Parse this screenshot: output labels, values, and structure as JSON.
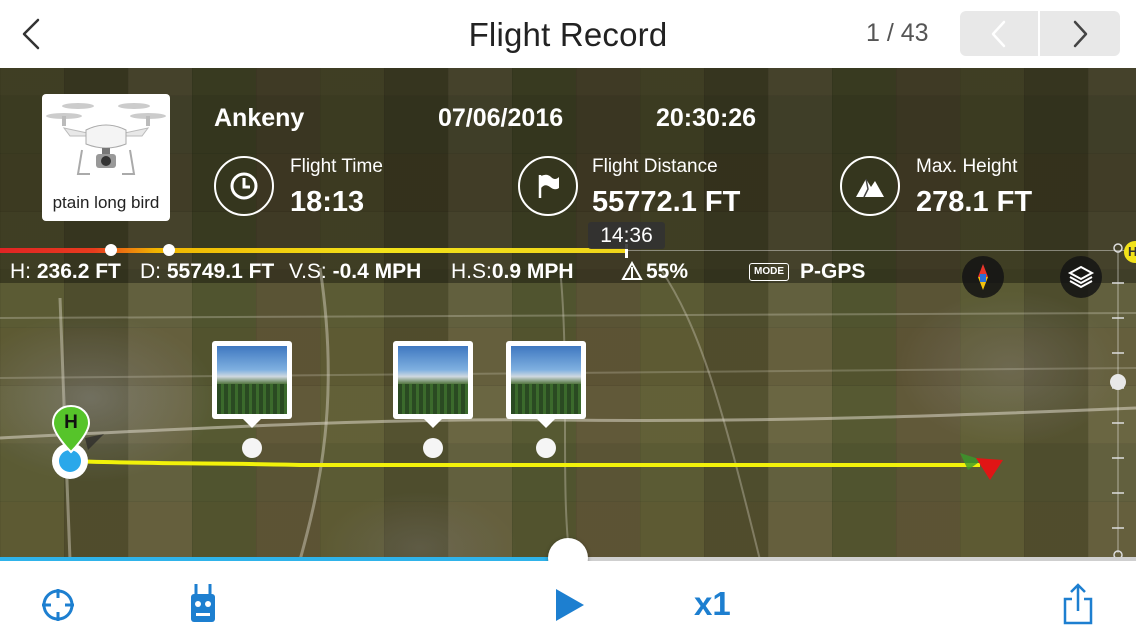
{
  "header": {
    "title": "Flight Record",
    "page_indicator": "1 / 43"
  },
  "flight": {
    "aircraft_name": "ptain long bird",
    "location": "Ankeny",
    "date": "07/06/2016",
    "time": "20:30:26",
    "flight_time_label": "Flight Time",
    "flight_time": "18:13",
    "flight_distance_label": "Flight Distance",
    "flight_distance": "55772.1 FT",
    "max_height_label": "Max. Height",
    "max_height": "278.1 FT"
  },
  "playback": {
    "current_time_tag": "14:36",
    "speed": "x1",
    "progress": 0.5
  },
  "telemetry": {
    "h_label": "H:",
    "h_value": "236.2 FT",
    "d_label": "D:",
    "d_value": "55749.1 FT",
    "vs_label": "V.S:",
    "vs_value": "-0.4 MPH",
    "hs_label": "H.S:",
    "hs_value": "0.9 MPH",
    "battery": "55%",
    "mode_badge": "MODE",
    "mode_value": "P-GPS"
  },
  "map": {
    "home_marker": "H",
    "right_marker": "H"
  },
  "colors": {
    "accent_blue": "#1d7fd0",
    "seek_blue": "#2fb3ea",
    "path_yellow": "#f2f20a",
    "home_green": "#56c42a"
  }
}
